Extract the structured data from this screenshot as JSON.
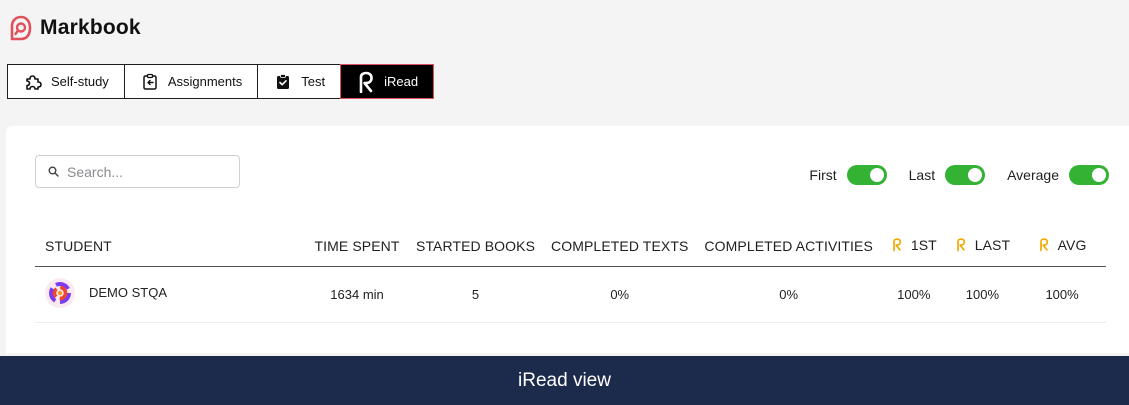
{
  "app": {
    "name": "Markbook",
    "brand_color": "#e0505a"
  },
  "tabs": [
    {
      "label": "Self-study",
      "icon": "puzzle-icon",
      "active": false
    },
    {
      "label": "Assignments",
      "icon": "clipboard-arrow-icon",
      "active": false
    },
    {
      "label": "Test",
      "icon": "clipboard-check-icon",
      "active": false
    },
    {
      "label": "iRead",
      "icon": "iread-logo-icon",
      "active": true
    }
  ],
  "search": {
    "placeholder": "Search...",
    "value": ""
  },
  "toggles": [
    {
      "label": "First",
      "on": true
    },
    {
      "label": "Last",
      "on": true
    },
    {
      "label": "Average",
      "on": true
    }
  ],
  "toggle_color": "#34b233",
  "iread_accent": "#f2a900",
  "table": {
    "columns": [
      "STUDENT",
      "TIME SPENT",
      "STARTED BOOKS",
      "COMPLETED TEXTS",
      "COMPLETED ACTIVITIES",
      "1ST",
      "LAST",
      "AVG"
    ],
    "rows": [
      {
        "student": "DEMO STQA",
        "time_spent": "1634 min",
        "started_books": "5",
        "completed_texts": "0%",
        "completed_activities": "0%",
        "first": "100%",
        "last": "100%",
        "avg": "100%"
      }
    ]
  },
  "footer": {
    "caption": "iRead view"
  }
}
